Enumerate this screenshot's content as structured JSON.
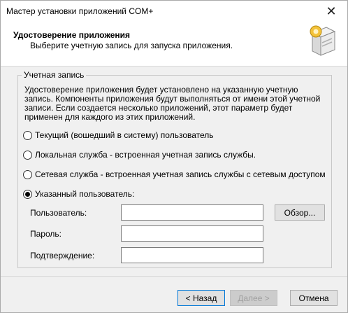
{
  "window": {
    "title": "Мастер установки приложений COM+",
    "close_glyph": "✕"
  },
  "header": {
    "title": "Удостоверение приложения",
    "subtitle": "Выберите учетную запись для запуска приложения.",
    "icon": "com-plus-box-icon"
  },
  "account_group": {
    "legend": "Учетная запись",
    "description": "Удостоверение приложения будет установлено на указанную учетную запись. Компоненты приложения будут выполняться от имени этой учетной записи.  Если создается несколько приложений, этот параметр будет применен для каждого из этих приложений.",
    "options": [
      {
        "label": "Текущий (вошедший в систему) пользователь",
        "checked": false
      },
      {
        "label": "Локальная служба - встроенная учетная запись службы.",
        "checked": false
      },
      {
        "label": "Сетевая служба - встроенная учетная запись службы с сетевым доступом",
        "checked": false
      },
      {
        "label": "Указанный пользователь:",
        "checked": true
      }
    ],
    "fields": {
      "user_label": "Пользователь:",
      "user_value": "",
      "password_label": "Пароль:",
      "password_value": "",
      "confirm_label": "Подтверждение:",
      "confirm_value": "",
      "browse_label": "Обзор..."
    }
  },
  "footer": {
    "back_label": "< Назад",
    "next_label": "Далее >",
    "cancel_label": "Отмена",
    "next_disabled": true
  }
}
